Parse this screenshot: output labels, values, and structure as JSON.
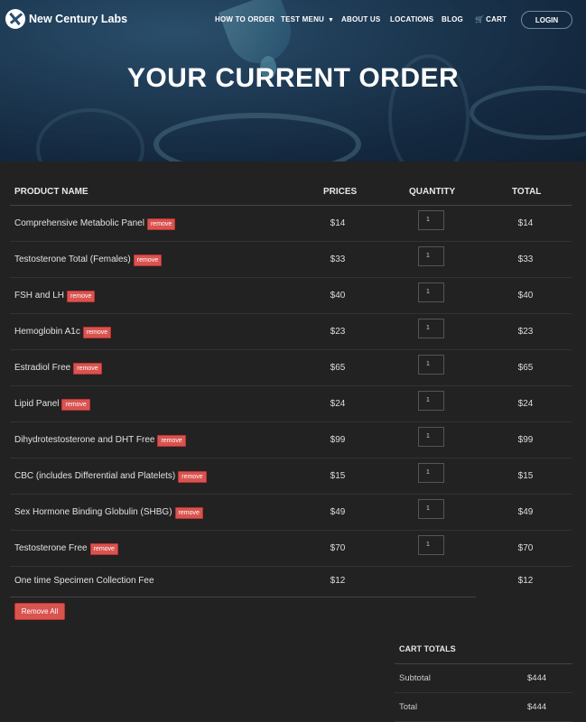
{
  "nav": {
    "brand": "New Century Labs",
    "items": [
      {
        "label": "HOW TO ORDER"
      },
      {
        "label": "TEST MENU"
      },
      {
        "label": "ABOUT US"
      },
      {
        "label": "LOCATIONS"
      },
      {
        "label": "BLOG"
      },
      {
        "label": "CART"
      }
    ],
    "login_label": "LOGIN"
  },
  "hero": {
    "title": "YOUR CURRENT ORDER"
  },
  "table": {
    "headers": {
      "product": "PRODUCT NAME",
      "prices": "PRICES",
      "quantity": "QUANTITY",
      "total": "TOTAL"
    },
    "remove_label": "remove",
    "rows": [
      {
        "name": "Comprehensive Metabolic Panel",
        "price": "$14",
        "qty": "1",
        "total": "$14"
      },
      {
        "name": "Testosterone Total (Females)",
        "price": "$33",
        "qty": "1",
        "total": "$33"
      },
      {
        "name": "FSH and LH",
        "price": "$40",
        "qty": "1",
        "total": "$40"
      },
      {
        "name": "Hemoglobin A1c",
        "price": "$23",
        "qty": "1",
        "total": "$23"
      },
      {
        "name": "Estradiol Free",
        "price": "$65",
        "qty": "1",
        "total": "$65"
      },
      {
        "name": "Lipid Panel",
        "price": "$24",
        "qty": "1",
        "total": "$24"
      },
      {
        "name": "Dihydrotestosterone and DHT Free",
        "price": "$99",
        "qty": "1",
        "total": "$99"
      },
      {
        "name": "CBC (includes Differential and Platelets)",
        "price": "$15",
        "qty": "1",
        "total": "$15"
      },
      {
        "name": "Sex Hormone Binding Globulin (SHBG)",
        "price": "$49",
        "qty": "1",
        "total": "$49"
      },
      {
        "name": "Testosterone Free",
        "price": "$70",
        "qty": "1",
        "total": "$70"
      }
    ],
    "fee": {
      "name": "One time Specimen Collection Fee",
      "price": "$12",
      "total": "$12"
    },
    "remove_all_label": "Remove All"
  },
  "totals": {
    "title": "CART TOTALS",
    "subtotal_label": "Subtotal",
    "subtotal": "$444",
    "total_label": "Total",
    "total": "$444"
  },
  "colors": {
    "accent_remove": "#d9534f",
    "background": "#222222"
  }
}
